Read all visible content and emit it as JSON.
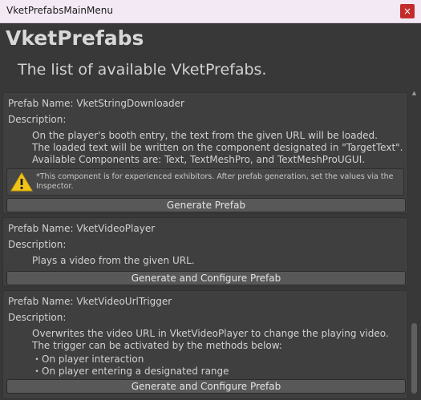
{
  "window": {
    "title": "VketPrefabsMainMenu",
    "close_glyph": "×"
  },
  "header": {
    "title": "VketPrefabs",
    "subtitle": "The list of available VketPrefabs."
  },
  "prefabs": [
    {
      "name_line": "Prefab Name: VketStringDownloader",
      "description_label": "Description:",
      "description": [
        "On the player's booth entry, the text from the given URL will be loaded.",
        "The loaded text will be written on the component designated in \"TargetText\".",
        "Available Components are: Text, TextMeshPro, and TextMeshProUGUI."
      ],
      "warning": {
        "icon": "warning-icon",
        "text": "*This component is for experienced exhibitors. After prefab generation, set the values via the Inspector."
      },
      "button": "Generate Prefab"
    },
    {
      "name_line": "Prefab Name: VketVideoPlayer",
      "description_label": "Description:",
      "description": [
        "Plays a video from the given URL."
      ],
      "button": "Generate and Configure Prefab"
    },
    {
      "name_line": "Prefab Name: VketVideoUrlTrigger",
      "description_label": "Description:",
      "description": [
        "Overwrites the video URL in VketVideoPlayer to change the playing video.",
        "The trigger can be activated by the methods below:",
        "・On player interaction",
        "・On player entering a designated range"
      ],
      "button": "Generate and Configure Prefab"
    }
  ],
  "colors": {
    "background": "#383838",
    "card": "#3f3f3f",
    "button": "#585858",
    "close": "#c42b2b",
    "warning": "#f0c419"
  }
}
